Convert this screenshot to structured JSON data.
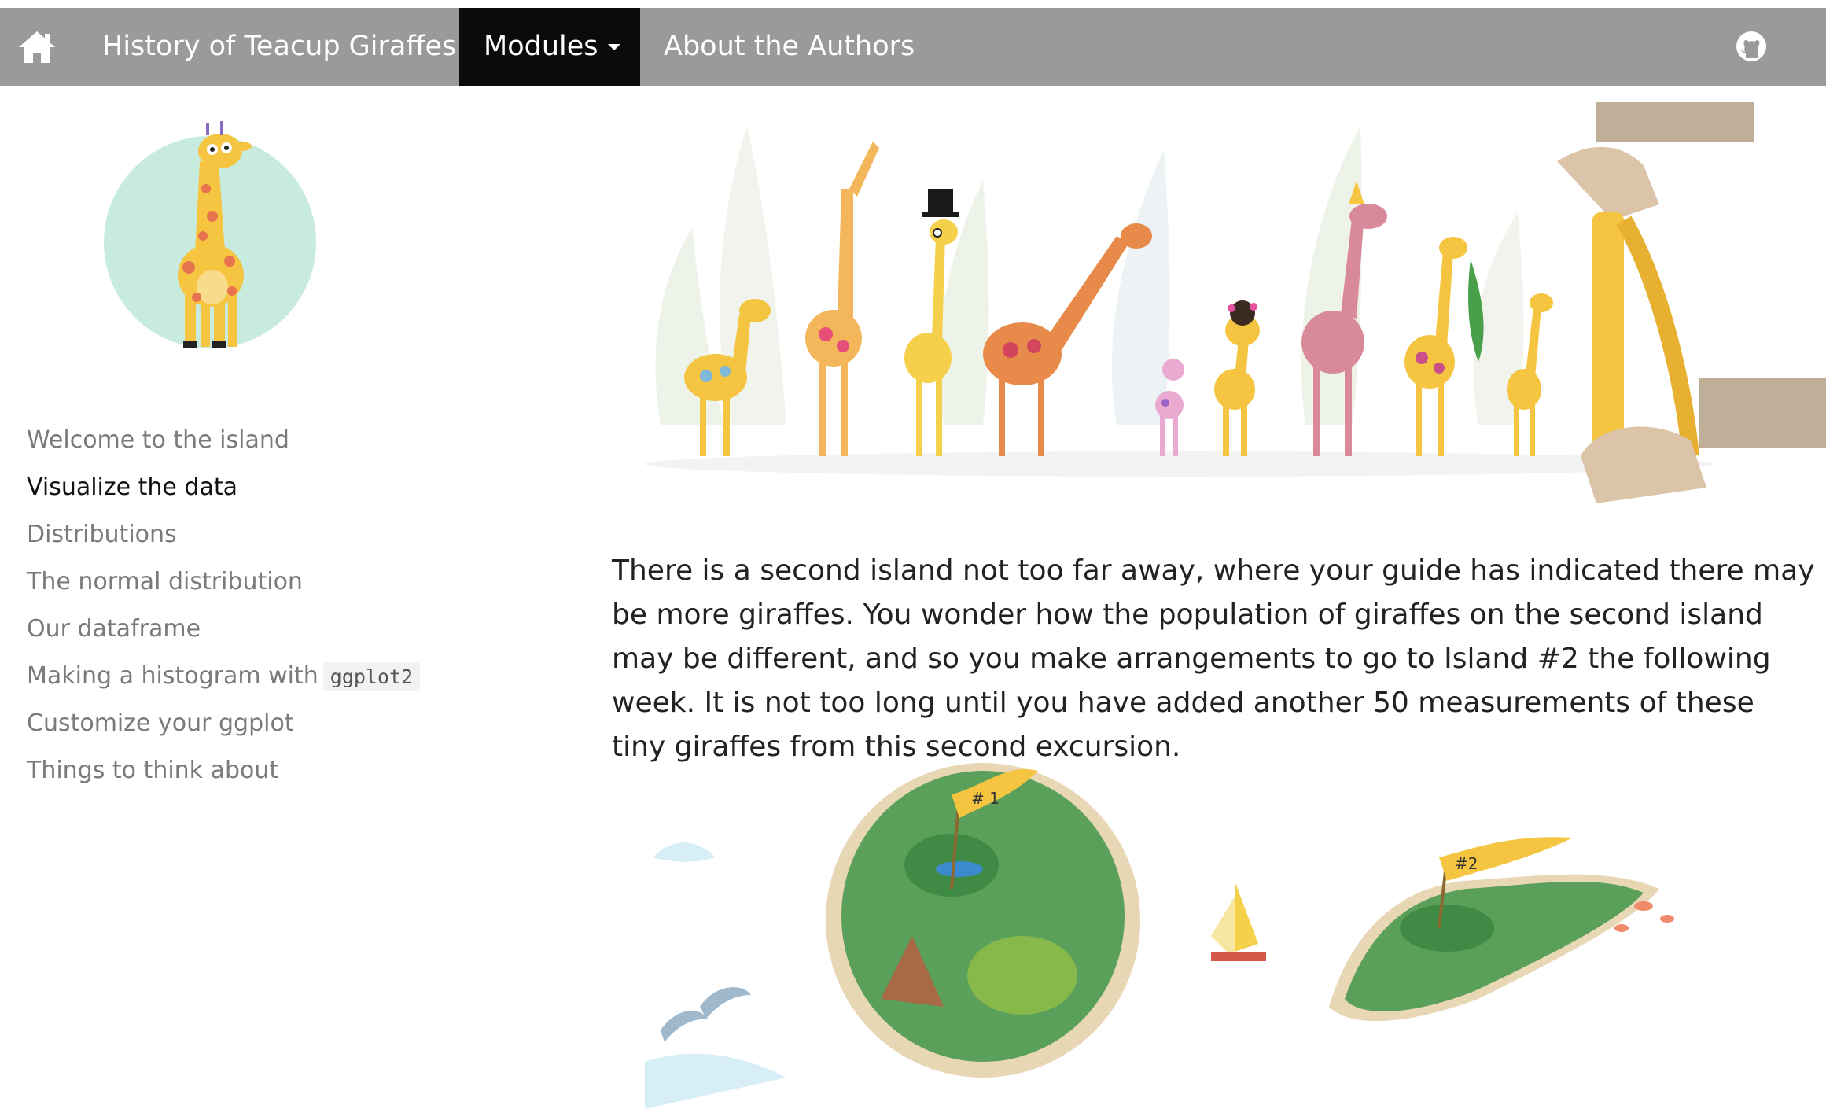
{
  "navbar": {
    "home_icon": "home-icon",
    "history_label": "History of Teacup Giraffes",
    "modules_label": "Modules",
    "about_label": "About the Authors",
    "github_icon": "github-icon"
  },
  "sidebar": {
    "items": [
      {
        "label": "Welcome to the island",
        "active": false
      },
      {
        "label": "Visualize the data",
        "active": true
      },
      {
        "label": "Distributions",
        "active": false
      },
      {
        "label": "The normal distribution",
        "active": false
      },
      {
        "label": "Our dataframe",
        "active": false
      },
      {
        "label": "Making a histogram with",
        "code": "ggplot2",
        "active": false
      },
      {
        "label": "Customize your ggplot",
        "active": false
      },
      {
        "label": "Things to think about",
        "active": false
      }
    ]
  },
  "main": {
    "paragraph": "There is a second island not too far away, where your guide has indicated there may be more giraffes. You wonder how the population of giraffes on the second island may be different, and so you make arrangements to go to Island #2 the following week. It is not too long until you have added another 50 measurements of these tiny giraffes from this second excursion.",
    "island1_flag": "# 1",
    "island2_flag": "#2"
  },
  "colors": {
    "navbar_bg": "#9a9a9a",
    "navbar_active_bg": "#0b0b0b",
    "avatar_circle": "#c8ebe0",
    "giraffe_yellow": "#f5c542",
    "giraffe_spot": "#e8734f"
  }
}
